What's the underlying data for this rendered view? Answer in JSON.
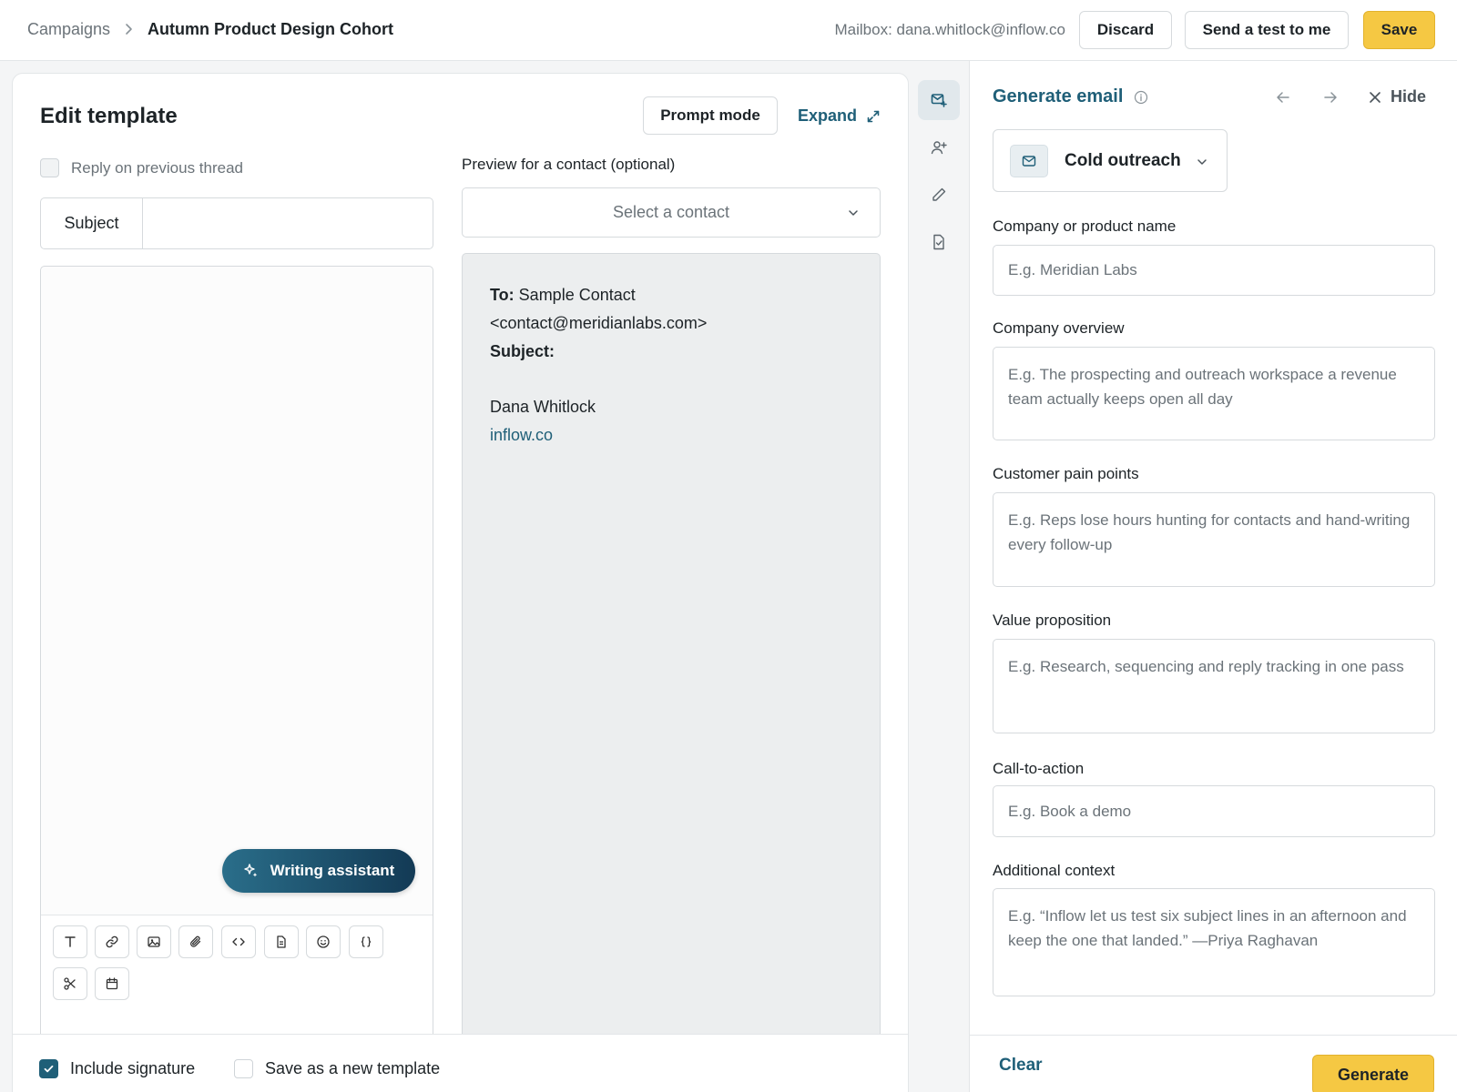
{
  "breadcrumb": {
    "root": "Campaigns",
    "current": "Autumn Product Design Cohort"
  },
  "header": {
    "mailbox": "Mailbox: dana.whitlock@inflow.co",
    "discard_label": "Discard",
    "send_test_label": "Send a test to me",
    "save_label": "Save"
  },
  "editor": {
    "title": "Edit template",
    "prompt_mode_label": "Prompt mode",
    "expand_label": "Expand",
    "reply_label": "Reply on previous thread",
    "reply_checked": false,
    "subject_label": "Subject",
    "subject_value": "",
    "writing_assistant_label": "Writing assistant",
    "toolbar_icons": [
      "text-format-icon",
      "link-icon",
      "image-icon",
      "attachment-icon",
      "code-icon",
      "document-icon",
      "emoji-icon",
      "variable-braces-icon",
      "scissors-icon",
      "calendar-icon"
    ]
  },
  "preview": {
    "label": "Preview for a contact (optional)",
    "select_placeholder": "Select a contact",
    "to_label": "To:",
    "to_value": "Sample Contact <contact@meridianlabs.com>",
    "subject_label": "Subject:",
    "signature_name": "Dana Whitlock",
    "signature_link": "inflow.co"
  },
  "footer": {
    "include_signature_label": "Include signature",
    "include_signature_checked": true,
    "save_new_template_label": "Save as a new template",
    "save_new_template_checked": false
  },
  "rail": {
    "items": [
      "generate-email-icon",
      "add-contact-icon",
      "pencil-icon",
      "document-check-icon"
    ],
    "active": "generate-email-icon"
  },
  "panel": {
    "title": "Generate email",
    "hide_label": "Hide",
    "email_type": "Cold outreach",
    "fields": [
      {
        "label": "Company or product name",
        "placeholder": "E.g. Meridian Labs"
      },
      {
        "label": "Company overview",
        "placeholder": "E.g. The prospecting and outreach workspace a revenue team actually keeps open all day"
      },
      {
        "label": "Customer pain points",
        "placeholder": "E.g. Reps lose hours hunting for contacts and hand-writing every follow-up"
      },
      {
        "label": "Value proposition",
        "placeholder": "E.g. Research, sequencing and reply tracking in one pass"
      },
      {
        "label": "Call-to-action",
        "placeholder": "E.g. Book a demo"
      },
      {
        "label": "Additional context",
        "placeholder": "E.g. “Inflow let us test six subject lines in an afternoon and keep the one that landed.” —Priya Raghavan"
      }
    ],
    "clear_label": "Clear",
    "generate_label": "Generate"
  },
  "colors": {
    "accent": "#1f5f78",
    "primary_button": "#f5c843",
    "writing_assistant_gradient": [
      "#2a6e8a",
      "#133a55"
    ]
  }
}
